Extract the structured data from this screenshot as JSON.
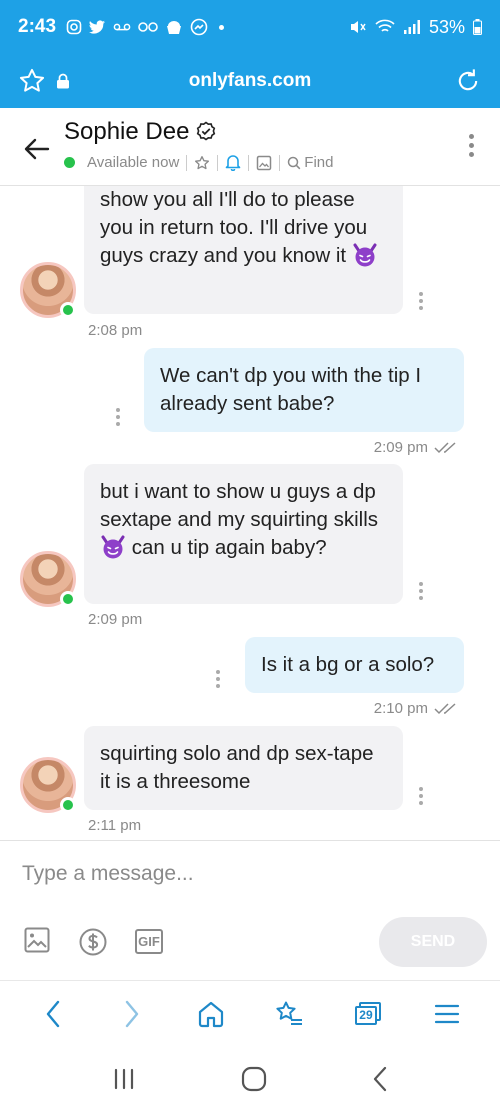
{
  "status_bar": {
    "time": "2:43",
    "battery": "53%"
  },
  "browser": {
    "url": "onlyfans.com"
  },
  "chat_header": {
    "name": "Sophie Dee",
    "status": "Available now",
    "find_label": "Find"
  },
  "messages": [
    {
      "direction": "incoming",
      "text": "show you all I'll do to please you in return too. I'll drive you guys crazy and you know it",
      "emoji": "smiling-devil",
      "time": "2:08 pm"
    },
    {
      "direction": "outgoing",
      "text": "We can't dp you with the tip I already sent babe?",
      "time": "2:09 pm"
    },
    {
      "direction": "incoming",
      "text_before_emoji": "but i want to show u guys a dp sextape and my squirting skills",
      "text_after_emoji": "can u tip again baby?",
      "emoji": "smiling-devil",
      "time": "2:09 pm"
    },
    {
      "direction": "outgoing",
      "text": "Is it a bg or a solo?",
      "time": "2:10 pm"
    },
    {
      "direction": "incoming",
      "text": "squirting solo and dp sex-tape it is a threesome",
      "time": "2:11 pm"
    }
  ],
  "composer": {
    "placeholder": "Type a message...",
    "send_label": "SEND",
    "gif_label": "GIF"
  },
  "browser_toolbar": {
    "tab_count": "29"
  },
  "colors": {
    "brand": "#1ea1e6",
    "online": "#27c24c",
    "incoming_bubble": "#f2f2f4",
    "outgoing_bubble": "#e3f3fc"
  }
}
